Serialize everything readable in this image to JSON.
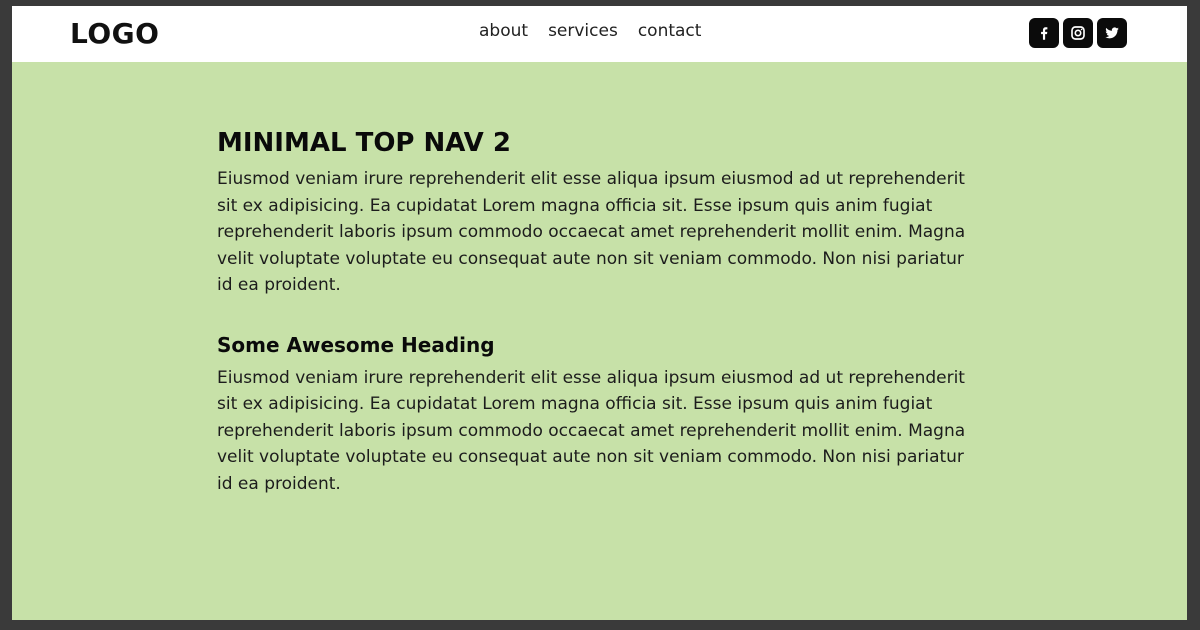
{
  "header": {
    "logo": "LOGO",
    "nav": [
      {
        "label": "about"
      },
      {
        "label": "services"
      },
      {
        "label": "contact"
      }
    ],
    "social": [
      {
        "icon": "facebook-icon"
      },
      {
        "icon": "instagram-icon"
      },
      {
        "icon": "twitter-icon"
      }
    ]
  },
  "main": {
    "title": "MINIMAL TOP NAV 2",
    "intro": "Eiusmod veniam irure reprehenderit elit esse aliqua ipsum eiusmod ad ut reprehenderit sit ex adipisicing. Ea cupidatat Lorem magna officia sit. Esse ipsum quis anim fugiat reprehenderit laboris ipsum commodo occaecat amet reprehenderit mollit enim. Magna velit voluptate voluptate eu consequat aute non sit veniam commodo. Non nisi pariatur id ea proident.",
    "section_heading": "Some Awesome Heading",
    "section_text": "Eiusmod veniam irure reprehenderit elit esse aliqua ipsum eiusmod ad ut reprehenderit sit ex adipisicing. Ea cupidatat Lorem magna officia sit. Esse ipsum quis anim fugiat reprehenderit laboris ipsum commodo occaecat amet reprehenderit mollit enim. Magna velit voluptate voluptate eu consequat aute non sit veniam commodo. Non nisi pariatur id ea proident."
  },
  "colors": {
    "page_background": "#c7e1a8",
    "nav_background": "#ffffff",
    "window_border": "#3a3a3a",
    "icon_background": "#0b0b0b"
  }
}
